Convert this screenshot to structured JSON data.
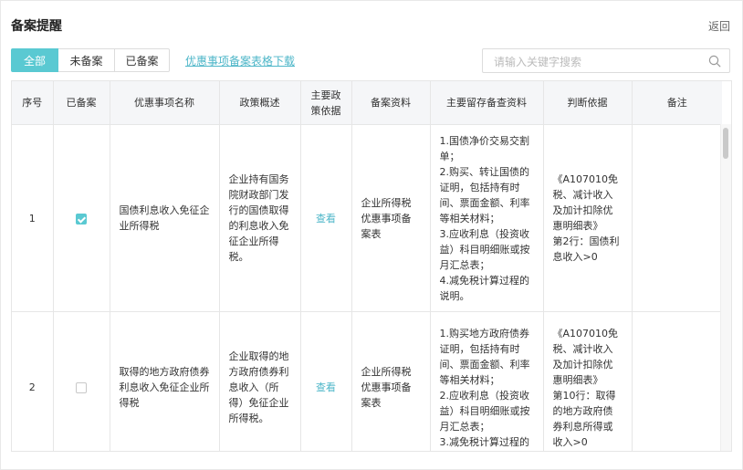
{
  "header": {
    "title": "备案提醒",
    "back_label": "返回"
  },
  "tabs": [
    {
      "label": "全部",
      "active": true
    },
    {
      "label": "未备案",
      "active": false
    },
    {
      "label": "已备案",
      "active": false
    }
  ],
  "download_link": "优惠事项备案表格下载",
  "search": {
    "placeholder": "请输入关键字搜索",
    "value": ""
  },
  "table": {
    "columns": [
      "序号",
      "已备案",
      "优惠事项名称",
      "政策概述",
      "主要政策依据",
      "备案资料",
      "主要留存备查资料",
      "判断依据",
      "备注"
    ],
    "rows": [
      {
        "index": "1",
        "filed": true,
        "name": "国债利息收入免征企业所得税",
        "policy_summary": "企业持有国务院财政部门发行的国债取得的利息收入免征企业所得税。",
        "policy_basis_link": "查看",
        "filing_materials": "企业所得税优惠事项备案表",
        "retained_materials": [
          "1.国债净价交易交割单；",
          "2.购买、转让国债的证明，包括持有时间、票面金额、利率等相关材料；",
          "3.应收利息（投资收益）科目明细账或按月汇总表；",
          "4.减免税计算过程的说明。"
        ],
        "judgment": [
          "《A107010免税、减计收入及加计扣除优惠明细表》",
          "第2行：国债利息收入>0"
        ],
        "remark": ""
      },
      {
        "index": "2",
        "filed": false,
        "name": "取得的地方政府债券利息收入免征企业所得税",
        "policy_summary": "企业取得的地方政府债券利息收入（所得）免征企业所得税。",
        "policy_basis_link": "查看",
        "filing_materials": "企业所得税优惠事项备案表",
        "retained_materials": [
          "1.购买地方政府债券证明，包括持有时间、票面金额、利率等相关材料；",
          "2.应收利息（投资收益）科目明细账或按月汇总表；",
          "3.减免税计算过程的"
        ],
        "judgment": [
          "《A107010免税、减计收入及加计扣除优惠明细表》",
          "第10行：取得的地方政府债券利息所得或收入>0"
        ],
        "remark": ""
      }
    ]
  },
  "colors": {
    "accent": "#5ac9d2",
    "link": "#4db6c8"
  }
}
